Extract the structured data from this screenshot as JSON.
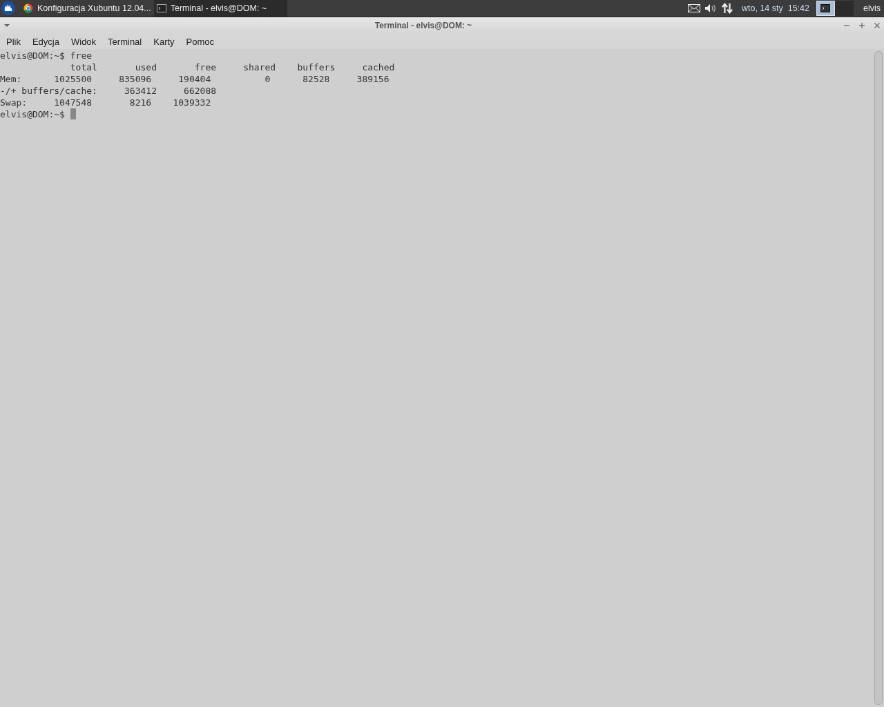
{
  "taskbar": {
    "tasks": [
      {
        "label": "Konfiguracja Xubuntu 12.04...",
        "kind": "browser",
        "selected": false
      },
      {
        "label": "Terminal - elvis@DOM: ~",
        "kind": "terminal",
        "selected": true
      }
    ],
    "clock": "wto, 14 sty  15:42",
    "workspaces": [
      {
        "selected": true
      },
      {
        "selected": false
      }
    ],
    "user": "elvis"
  },
  "window": {
    "title": "Terminal - elvis@DOM: ~"
  },
  "menu": [
    "Plik",
    "Edycja",
    "Widok",
    "Terminal",
    "Karty",
    "Pomoc"
  ],
  "terminal": {
    "lines": [
      "elvis@DOM:~$ free",
      "             total       used       free     shared    buffers     cached",
      "Mem:      1025500     835096     190404          0      82528     389156",
      "-/+ buffers/cache:     363412     662088",
      "Swap:     1047548       8216    1039332",
      "elvis@DOM:~$ "
    ],
    "cursor": true
  }
}
